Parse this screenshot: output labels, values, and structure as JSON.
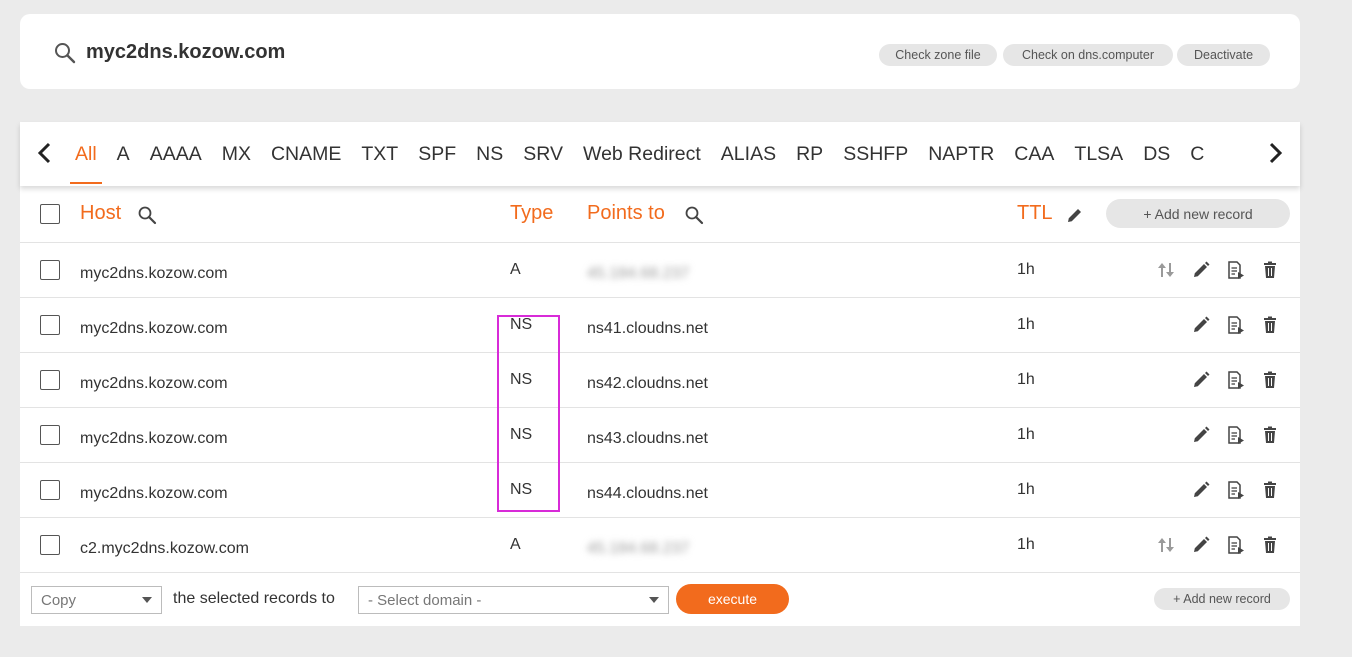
{
  "header": {
    "zone_name": "myc2dns.kozow.com",
    "buttons": [
      "Check zone file",
      "Check on dns.computer",
      "Deactivate"
    ]
  },
  "tabs": {
    "items": [
      "All",
      "A",
      "AAAA",
      "MX",
      "CNAME",
      "TXT",
      "SPF",
      "NS",
      "SRV",
      "Web Redirect",
      "ALIAS",
      "RP",
      "SSHFP",
      "NAPTR",
      "CAA",
      "TLSA",
      "DS",
      "C"
    ],
    "active": "All"
  },
  "table": {
    "headers": {
      "host": "Host",
      "type": "Type",
      "points_to": "Points to",
      "ttl": "TTL"
    },
    "add_record_label": "+ Add new record",
    "rows": [
      {
        "host": "myc2dns.kozow.com",
        "type": "A",
        "points_to": "45.184.68.237",
        "ttl": "1h"
      },
      {
        "host": "myc2dns.kozow.com",
        "type": "NS",
        "points_to": "ns41.cloudns.net",
        "ttl": "1h"
      },
      {
        "host": "myc2dns.kozow.com",
        "type": "NS",
        "points_to": "ns42.cloudns.net",
        "ttl": "1h"
      },
      {
        "host": "myc2dns.kozow.com",
        "type": "NS",
        "points_to": "ns43.cloudns.net",
        "ttl": "1h"
      },
      {
        "host": "myc2dns.kozow.com",
        "type": "NS",
        "points_to": "ns44.cloudns.net",
        "ttl": "1h"
      },
      {
        "host": "c2.myc2dns.kozow.com",
        "type": "A",
        "points_to": "45.184.68.237",
        "ttl": "1h"
      }
    ]
  },
  "footer": {
    "action_select": "Copy",
    "middle_text": "the selected records to",
    "domain_select_placeholder": "- Select domain -",
    "execute_label": "execute",
    "add_record_label": "+ Add new record"
  },
  "colors": {
    "accent": "#f26b1d",
    "highlight": "#d82bd8",
    "background": "#ebebeb"
  }
}
